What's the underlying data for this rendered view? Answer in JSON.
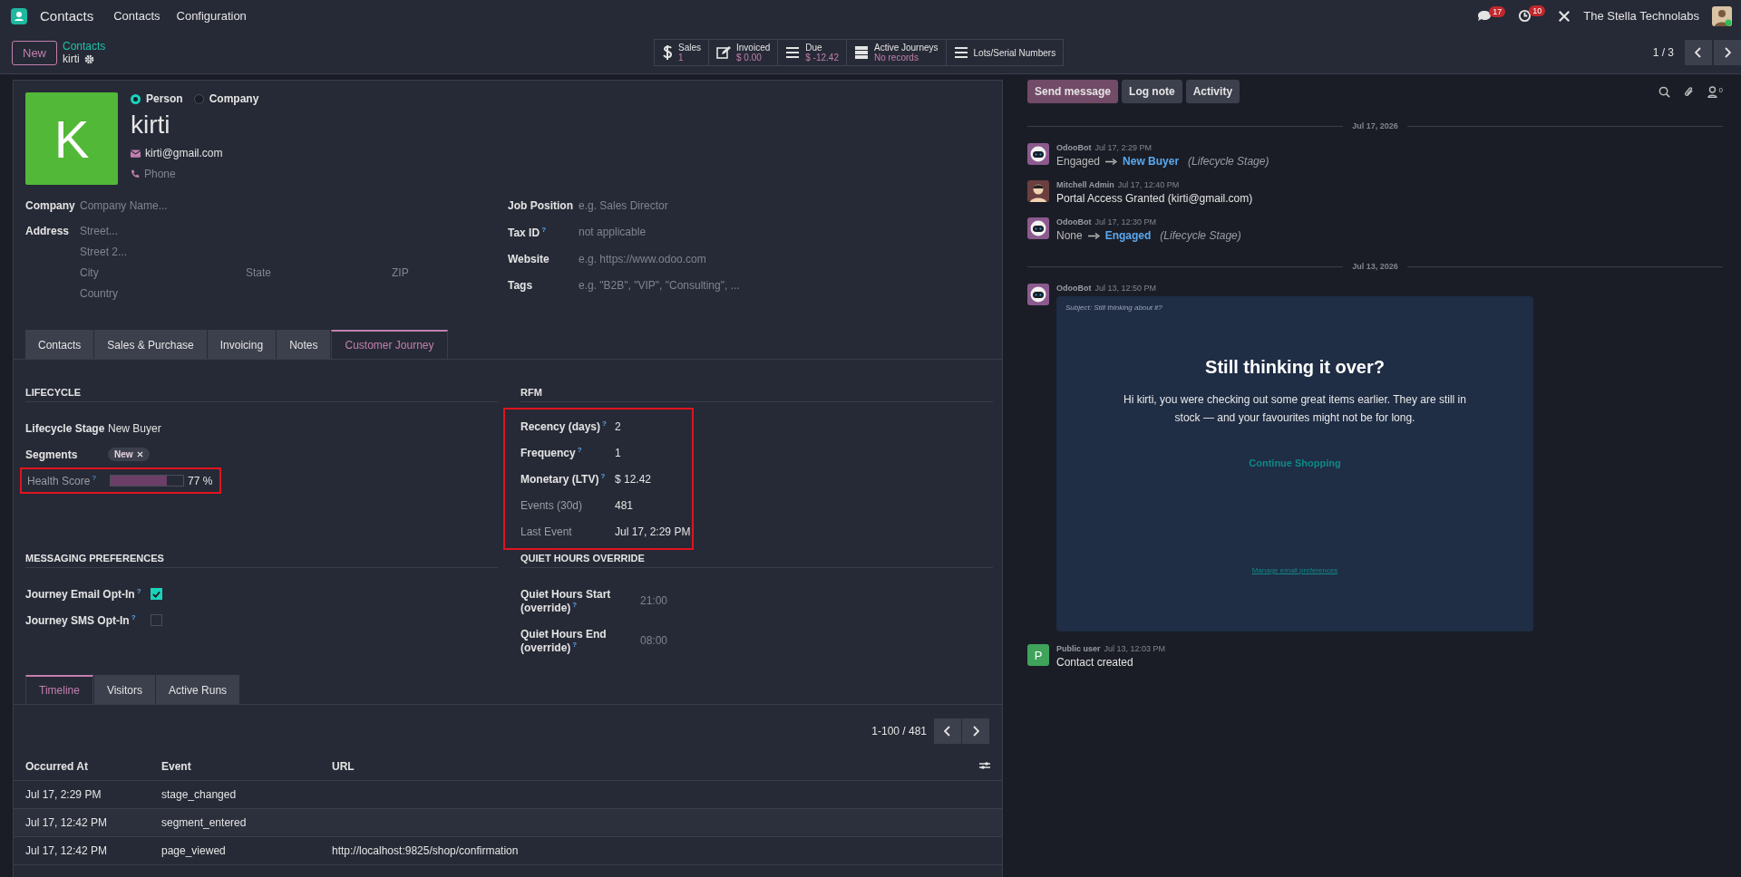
{
  "navbar": {
    "app_name": "Contacts",
    "menu": [
      "Contacts",
      "Configuration"
    ],
    "messages_count": "17",
    "activities_count": "10",
    "company": "The Stella Technolabs"
  },
  "control_panel": {
    "new_button": "New",
    "breadcrumb": "Contacts",
    "record": "kirti",
    "pager": "1 / 3",
    "smart_buttons": [
      {
        "kind": "dollar",
        "label": "Sales",
        "value": "1"
      },
      {
        "kind": "invoice",
        "label": "Invoiced",
        "value": "$ 0.00"
      },
      {
        "kind": "list",
        "label": "Due",
        "value": "$ -12.42"
      },
      {
        "kind": "journeys",
        "label": "Active Journeys",
        "value": "No records"
      },
      {
        "kind": "list",
        "label": "Lots/Serial Numbers"
      }
    ]
  },
  "form": {
    "type_options": [
      {
        "label": "Person",
        "selected": true
      },
      {
        "label": "Company",
        "selected": false
      }
    ],
    "avatar_letter": "K",
    "name": "kirti",
    "email": "kirti@gmail.com",
    "phone_placeholder": "Phone",
    "company": {
      "label": "Company",
      "placeholder": "Company Name..."
    },
    "address": {
      "label": "Address",
      "street": "Street...",
      "street2": "Street 2...",
      "city": "City",
      "state": "State",
      "zip": "ZIP",
      "country": "Country"
    },
    "right_fields": [
      {
        "label": "Job Position",
        "placeholder": "e.g. Sales Director"
      },
      {
        "label": "Tax ID$^{?}$",
        "placeholder": "not applicable"
      },
      {
        "label": "Website",
        "placeholder": "e.g. https://www.odoo.com"
      },
      {
        "label": "Tags",
        "placeholder": "e.g. \"B2B\", \"VIP\", \"Consulting\", ..."
      }
    ],
    "tabs": [
      {
        "label": "Contacts",
        "selected": false
      },
      {
        "label": "Sales & Purchase",
        "selected": false
      },
      {
        "label": "Invoicing",
        "selected": false
      },
      {
        "label": "Notes",
        "selected": false
      },
      {
        "label": "Customer Journey",
        "selected": true
      }
    ],
    "lifecycle": {
      "title": "LIFECYCLE",
      "stage": {
        "label": "Lifecycle Stage",
        "value": "New Buyer"
      },
      "segments": {
        "label": "Segments",
        "tags": [
          "New"
        ]
      },
      "health": {
        "label": "Health Score$^{?}$",
        "level": 0.77,
        "reading": "77 %",
        "highlighted": true
      }
    },
    "rfm": {
      "title": "RFM",
      "highlighted": true,
      "rows": [
        {
          "label": "Recency (days)$^{?}$",
          "value": "2",
          "readonly": false
        },
        {
          "label": "Frequency$^{?}$",
          "value": "1",
          "readonly": false
        },
        {
          "label": "Monetary (LTV)$^{?}$",
          "value": "$ 12.42",
          "readonly": false
        },
        {
          "label": "Events (30d)",
          "value": "481",
          "readonly": true
        },
        {
          "label": "Last Event",
          "value": "Jul 17, 2:29 PM",
          "readonly": true
        }
      ]
    },
    "messaging": {
      "title": "MESSAGING PREFERENCES",
      "options": [
        {
          "label": "Journey Email Opt-In$^{?}$",
          "checked": true
        },
        {
          "label": "Journey SMS Opt-In$^{?}$",
          "checked": false
        }
      ]
    },
    "quiet_hours": {
      "title": "QUIET HOURS OVERRIDE",
      "fields": [
        {
          "label": "Quiet Hours Start (override)$^{?}$",
          "placeholder": "21:00"
        },
        {
          "label": "Quiet Hours End (override)$^{?}$",
          "placeholder": "08:00"
        }
      ]
    },
    "sub_tabs": [
      {
        "label": "Timeline",
        "selected": true
      },
      {
        "label": "Visitors",
        "selected": false
      },
      {
        "label": "Active Runs",
        "selected": false
      }
    ],
    "table": {
      "pager": "1-100 / 481",
      "columns": [
        "Occurred At",
        "Event",
        "URL"
      ],
      "rows": [
        [
          "Jul 17, 2:29 PM",
          "stage_changed",
          ""
        ],
        [
          "Jul 17, 12:42 PM",
          "segment_entered",
          ""
        ],
        [
          "Jul 17, 12:42 PM",
          "page_viewed",
          "http://localhost:9825/shop/confirmation"
        ]
      ]
    }
  },
  "chatter": {
    "buttons": [
      {
        "label": "Send message",
        "selected": true
      },
      {
        "label": "Log note",
        "selected": false
      },
      {
        "label": "Activity",
        "selected": false
      }
    ],
    "followers_count": "0",
    "feed": [
      {
        "kind": "date",
        "text": "Jul 17, 2026"
      },
      {
        "kind": "tracking",
        "avatar": {
          "kind": "bot"
        },
        "author": "OdooBot",
        "time": "Jul 17, 2:29 PM",
        "old": "Engaged",
        "new": "New Buyer",
        "field": "(Lifecycle Stage)"
      },
      {
        "kind": "message",
        "avatar": {
          "kind": "person"
        },
        "author": "Mitchell Admin",
        "time": "Jul 17, 12:40 PM",
        "body": "Portal Access Granted (kirti@gmail.com)"
      },
      {
        "kind": "tracking",
        "avatar": {
          "kind": "bot"
        },
        "author": "OdooBot",
        "time": "Jul 17, 12:30 PM",
        "old": "None",
        "new": "Engaged",
        "field": "(Lifecycle Stage)"
      },
      {
        "kind": "date",
        "text": "Jul 13, 2026"
      },
      {
        "kind": "email",
        "avatar": {
          "kind": "bot"
        },
        "author": "OdooBot",
        "time": "Jul 13, 12:50 PM",
        "subject": "Subject: Still thinking about it?",
        "heading": "Still thinking it over?",
        "body": "Hi kirti, you were checking out some great items earlier. They are still in stock — and your favourites might not be for long.",
        "button": "Continue Shopping",
        "footer_link": "Manage email preferences"
      },
      {
        "kind": "message",
        "avatar": {
          "kind": "letter",
          "letter": "P"
        },
        "author": "Public user",
        "time": "Jul 13, 12:03 PM",
        "body": "Contact created"
      }
    ]
  }
}
